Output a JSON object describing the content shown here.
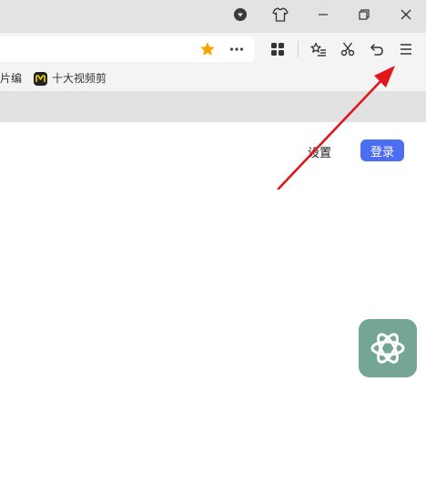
{
  "titlebar": {
    "icons": [
      "download-indicator-icon",
      "skin-tshirt-icon",
      "minimize-icon",
      "restore-icon",
      "close-icon"
    ]
  },
  "toolbar": {
    "address_icons": [
      "bookmark-star-icon",
      "more-dots-icon"
    ],
    "icons": [
      "apps-grid-icon",
      "favorites-list-icon",
      "scissors-icon",
      "undo-icon",
      "menu-icon"
    ]
  },
  "bookmarks": {
    "items": [
      {
        "label": "片编"
      },
      {
        "label": "十大视频剪"
      }
    ]
  },
  "page": {
    "settings_label": "设置",
    "login_label": "登录"
  },
  "colors": {
    "accent": "#4e6ef2",
    "star": "#f5a300",
    "annotation": "#e0161b",
    "widget": "#74a595"
  }
}
